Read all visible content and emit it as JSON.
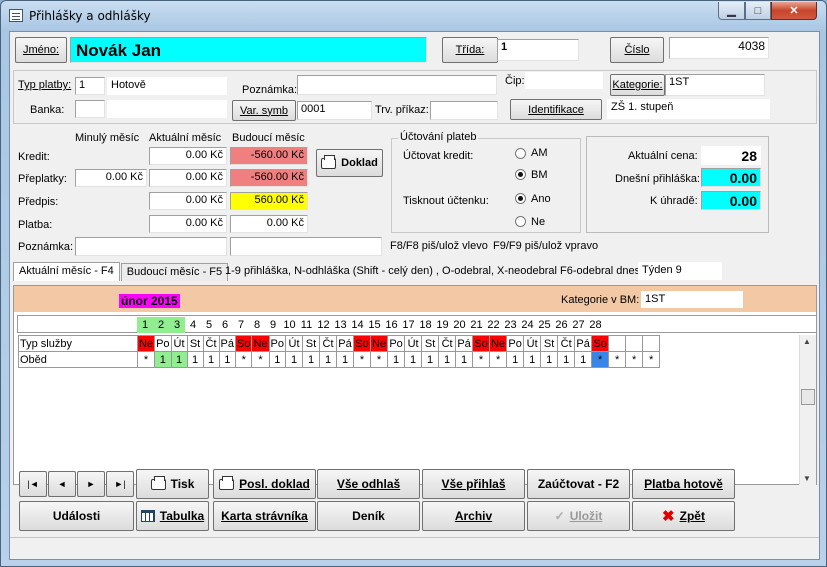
{
  "window": {
    "title": "Přihlášky a odhlášky"
  },
  "header": {
    "name_label": "Jméno:",
    "name_value": "Novák Jan",
    "class_label": "Třída:",
    "class_value": "1",
    "number_label": "Číslo",
    "number_value": "4038"
  },
  "payment": {
    "type_label": "Typ platby:",
    "type_code": "1",
    "type_name": "Hotově",
    "bank_label": "Banka:",
    "bank_value": "",
    "bank_name": "",
    "varsym_button": "Var. symb",
    "varsym_value": "0001",
    "trvprikaz_label": "Trv. příkaz:",
    "trvprikaz_value": ""
  },
  "info": {
    "note_label": "Poznámka:",
    "note_value": "",
    "chip_label": "Čip:",
    "chip_value": "",
    "category_button": "Kategorie:",
    "category_value": "1ST",
    "identification_button": "Identifikace",
    "school_value": "ZŠ 1. stupeň"
  },
  "finance": {
    "col_prev": "Minulý měsíc",
    "col_curr": "Aktuální měsíc",
    "col_next": "Budoucí měsíc",
    "rows": [
      {
        "label": "Kredit:",
        "prev": "",
        "curr": "0.00 Kč",
        "next": "-560.00 Kč"
      },
      {
        "label": "Přeplatky:",
        "prev": "0.00 Kč",
        "curr": "0.00 Kč",
        "next": "-560.00 Kč"
      },
      {
        "label": "Předpis:",
        "prev": "",
        "curr": "0.00 Kč",
        "next": "560.00 Kč"
      },
      {
        "label": "Platba:",
        "prev": "",
        "curr": "0.00 Kč",
        "next": "0.00 Kč"
      }
    ],
    "note_label": "Poznámka:",
    "note_curr": "",
    "note_next": "",
    "doklad_button": "Doklad",
    "hint_left": "F8/F8 piš/ulož vlevo",
    "hint_right": "F9/F9 piš/ulož vpravo"
  },
  "accounting": {
    "title": "Účtování plateb",
    "credit_label": "Účtovat kredit:",
    "opt_am": "AM",
    "opt_bm": "BM",
    "receipt_label": "Tisknout účtenku:",
    "opt_yes": "Ano",
    "opt_no": "Ne"
  },
  "prices": {
    "current_label": "Aktuální cena:",
    "current_value": "28",
    "today_label": "Dnešní přihláška:",
    "today_value": "0.00",
    "due_label": "K úhradě:",
    "due_value": "0.00"
  },
  "tabs": {
    "current": "Aktuální měsíc - F4",
    "future": "Budoucí měsíc - F5",
    "hint": "1-9 přihláška, N-odhláška  (Shift - celý den) ,  O-odebral, X-neodebral   F6-odebral dnes",
    "week": "Týden 9"
  },
  "calendar": {
    "month": "únor 2015",
    "cat_label": "Kategorie v BM:",
    "cat_value": "1ST",
    "days": [
      "1",
      "2",
      "3",
      "4",
      "5",
      "6",
      "7",
      "8",
      "9",
      "10",
      "11",
      "12",
      "13",
      "14",
      "15",
      "16",
      "17",
      "18",
      "19",
      "20",
      "21",
      "22",
      "23",
      "24",
      "25",
      "26",
      "27",
      "28"
    ],
    "service_header": "Typ služby",
    "weekdays": [
      "Ne",
      "Po",
      "Út",
      "St",
      "Čt",
      "Pá",
      "So",
      "Ne",
      "Po",
      "Út",
      "St",
      "Čt",
      "Pá",
      "So",
      "Ne",
      "Po",
      "Út",
      "St",
      "Čt",
      "Pá",
      "So",
      "Ne",
      "Po",
      "Út",
      "St",
      "Čt",
      "Pá",
      "So"
    ],
    "service": "Oběd",
    "cells": [
      "*",
      "1",
      "1",
      "1",
      "1",
      "1",
      "*",
      "*",
      "1",
      "1",
      "1",
      "1",
      "1",
      "*",
      "*",
      "1",
      "1",
      "1",
      "1",
      "1",
      "*",
      "*",
      "1",
      "1",
      "1",
      "1",
      "1",
      "*"
    ],
    "extra": [
      "*",
      "*",
      "*"
    ]
  },
  "buttons": {
    "first": "|◄",
    "prev": "◄",
    "next": "►",
    "last": "►|",
    "print": "Tisk",
    "last_doc": "Posl. doklad",
    "unsub_all": "Vše odhlaš",
    "sub_all": "Vše přihlaš",
    "post": "Zaúčtovat - F2",
    "pay_cash": "Platba hotově",
    "events": "Události",
    "table": "Tabulka",
    "card": "Karta strávníka",
    "diary": "Deník",
    "archive": "Archiv",
    "save": "Uložit",
    "back": "Zpět"
  },
  "colors": {
    "name_bg": "#00ffff",
    "neg_bg": "#f08080",
    "pos_bg": "#ffff00",
    "weekend_bg": "#ff0000",
    "present_bg": "#90ee90",
    "today_bg": "#3a86e8",
    "month_bg": "#ff00ff",
    "header_bg": "#f2c9a4"
  }
}
